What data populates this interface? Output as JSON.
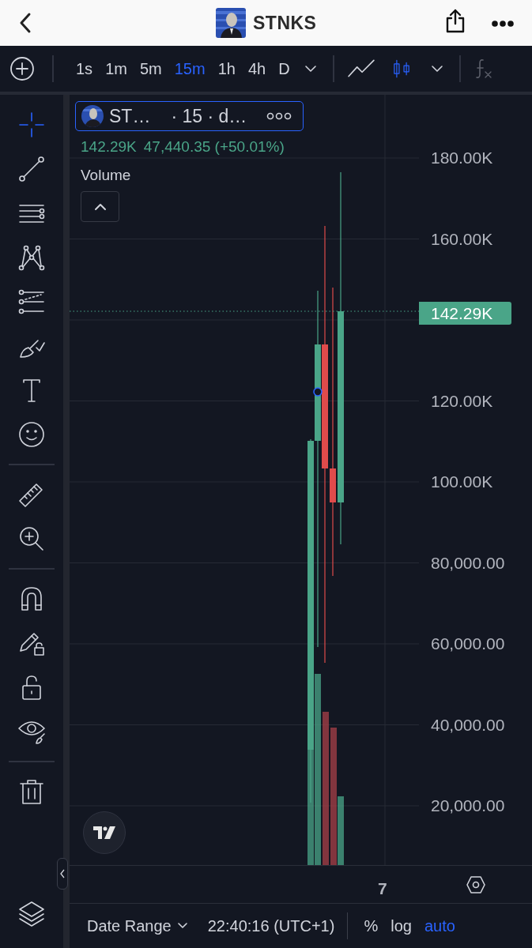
{
  "header": {
    "title": "STNKS"
  },
  "toolbar": {
    "timeframes": [
      {
        "label": "1s",
        "selected": false
      },
      {
        "label": "1m",
        "selected": false
      },
      {
        "label": "5m",
        "selected": false
      },
      {
        "label": "15m",
        "selected": true
      },
      {
        "label": "1h",
        "selected": false
      },
      {
        "label": "4h",
        "selected": false
      },
      {
        "label": "D",
        "selected": false
      }
    ],
    "chart_types": [
      {
        "kind": "line",
        "selected": false
      },
      {
        "kind": "candles",
        "selected": true
      }
    ]
  },
  "tool_groups": [
    [
      {
        "kind": "crosshair",
        "selected": true
      },
      {
        "kind": "trend-line",
        "selected": false
      },
      {
        "kind": "parallel-lines",
        "selected": false
      },
      {
        "kind": "pattern",
        "selected": false
      },
      {
        "kind": "fib",
        "selected": false
      },
      {
        "kind": "brush",
        "selected": false
      },
      {
        "kind": "text",
        "selected": false
      },
      {
        "kind": "emoji",
        "selected": false
      }
    ],
    [
      {
        "kind": "ruler",
        "selected": false
      },
      {
        "kind": "zoom",
        "selected": false
      }
    ],
    [
      {
        "kind": "magnet",
        "selected": false
      },
      {
        "kind": "pencil-lock",
        "selected": false
      },
      {
        "kind": "lock",
        "selected": false
      },
      {
        "kind": "eye",
        "selected": false
      }
    ],
    [
      {
        "kind": "trash",
        "selected": false
      }
    ]
  ],
  "legend": {
    "symbol": "ST…",
    "interval": "· 15 · d…",
    "price": "142.29K",
    "change": "47,440.35 (+50.01%)",
    "indicator": "Volume"
  },
  "price_axis": {
    "ticks": [
      "180.00K",
      "160.00K",
      "120.00K",
      "100.00K",
      "80,000.00",
      "60,000.00",
      "40,000.00",
      "20,000.00"
    ],
    "current_price": "142.29K"
  },
  "time_axis": {
    "labels": [
      "7"
    ]
  },
  "bottom_bar": {
    "date_range": "Date Range",
    "time": "22:40:16 (UTC+1)",
    "scales": [
      {
        "label": "%",
        "selected": false
      },
      {
        "label": "log",
        "selected": false
      },
      {
        "label": "auto",
        "selected": true
      }
    ]
  }
}
